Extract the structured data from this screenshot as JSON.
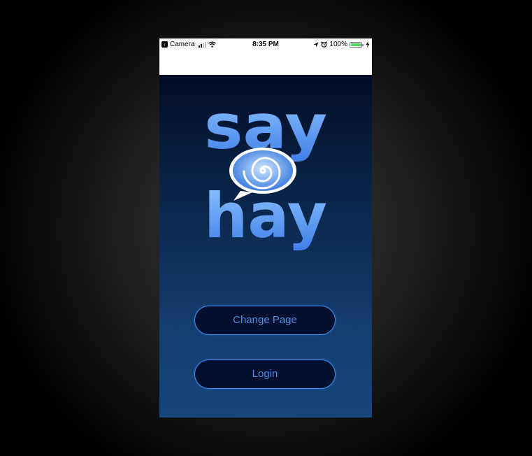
{
  "status_bar": {
    "back_app": "Camera",
    "time": "8:35 PM",
    "battery": "100%",
    "icons": [
      "back-arrow-icon",
      "signal-icon",
      "wifi-icon",
      "location-icon",
      "alarm-icon",
      "battery-icon",
      "charging-icon"
    ]
  },
  "logo": {
    "word_top": "say",
    "word_bottom": "hay",
    "icon": "spiral-speech-bubble-icon"
  },
  "buttons": {
    "change_page": "Change Page",
    "login": "Login"
  },
  "colors": {
    "background_top": "#020e27",
    "background_bottom": "#17467b",
    "button_fill": "#020f2e",
    "button_border": "#3a8ef0",
    "button_text": "#4c8fe6",
    "logo_light": "#8ec6ff",
    "logo_dark": "#3f7ee8",
    "battery": "#4cd964"
  }
}
